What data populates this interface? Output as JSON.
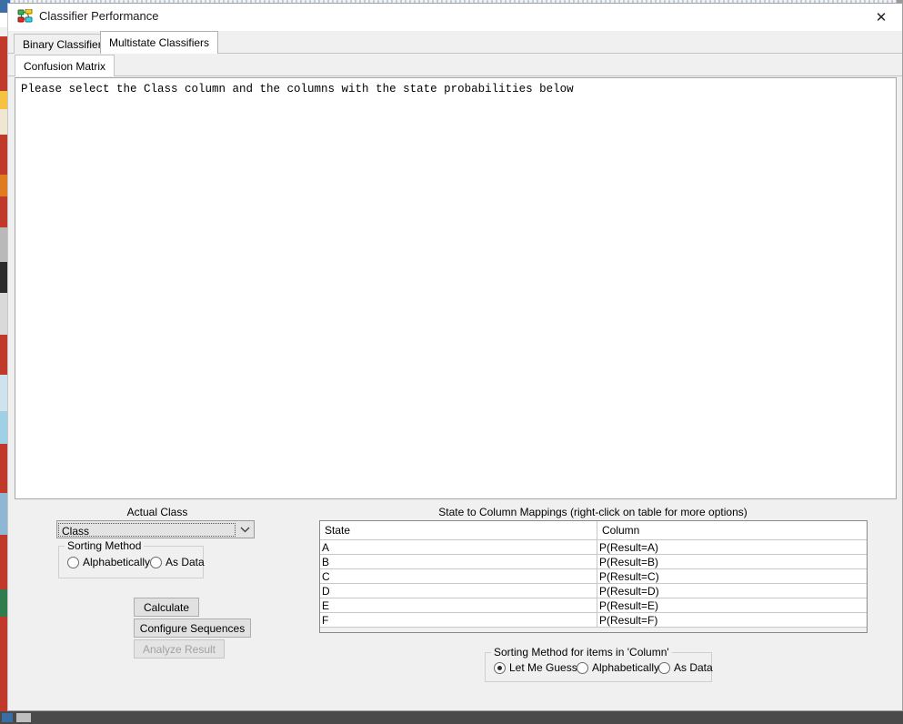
{
  "window": {
    "title": "Classifier Performance",
    "icon": "network-nodes-icon",
    "close_label": "✕"
  },
  "tabs_main": [
    {
      "label": "Binary Classifiers",
      "active": false
    },
    {
      "label": "Multistate Classifiers",
      "active": true
    }
  ],
  "tabs_sub": [
    {
      "label": "Confusion Matrix",
      "active": true
    }
  ],
  "message_panel": {
    "text": "Please select the Class column and the columns with the state probabilities below"
  },
  "actual_class": {
    "caption": "Actual Class",
    "selected_value": "Class",
    "dropdown_arrow": "⌄",
    "sorting_group_label": "Sorting Method",
    "options": [
      {
        "label": "Alphabetically",
        "selected": false
      },
      {
        "label": "As Data",
        "selected": false
      }
    ]
  },
  "buttons": {
    "calculate": "Calculate",
    "configure_sequences": "Configure Sequences",
    "analyze_result": "Analyze Result",
    "analyze_result_enabled": false
  },
  "mapping": {
    "caption": "State to Column Mappings (right-click on table for more options)",
    "headers": [
      "State",
      "Column"
    ],
    "rows": [
      {
        "state": "A",
        "column": "P(Result=A)"
      },
      {
        "state": "B",
        "column": "P(Result=B)"
      },
      {
        "state": "C",
        "column": "P(Result=C)"
      },
      {
        "state": "D",
        "column": "P(Result=D)"
      },
      {
        "state": "E",
        "column": "P(Result=E)"
      },
      {
        "state": "F",
        "column": "P(Result=F)"
      }
    ]
  },
  "column_sorting": {
    "group_label": "Sorting Method for items in 'Column'",
    "options": [
      {
        "label": "Let Me Guess",
        "selected": true
      },
      {
        "label": "Alphabetically",
        "selected": false
      },
      {
        "label": "As Data",
        "selected": false
      }
    ]
  },
  "colors": {
    "window_background": "#f0f0f0",
    "panel_background": "#ffffff",
    "accent_red": "#c0392b",
    "accent_navy": "#191970",
    "disabled_text": "#a2a2a2"
  }
}
